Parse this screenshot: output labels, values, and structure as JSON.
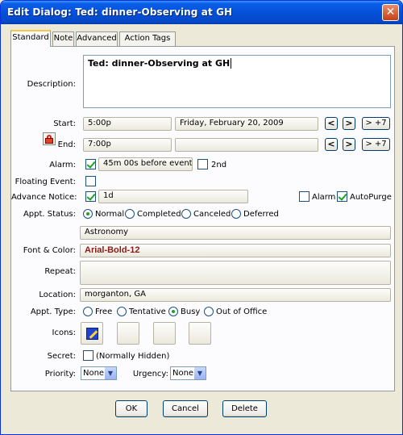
{
  "window": {
    "title": "Edit Dialog:  Ted: dinner-Observing at GH"
  },
  "tabs": [
    {
      "label": "Standard"
    },
    {
      "label": "Note"
    },
    {
      "label": "Advanced"
    },
    {
      "label": "Action Tags"
    }
  ],
  "form": {
    "description_label": "Description:",
    "description_value": "Ted: dinner-Observing at GH",
    "start_label": "Start:",
    "start_time": "5:00p",
    "start_date": "Friday, February 20, 2009",
    "end_label": "End:",
    "end_time": "7:00p",
    "end_date": "",
    "nav_prev": "<",
    "nav_next": ">",
    "nav_plus7": "> +7",
    "alarm_label": "Alarm:",
    "alarm_value": "45m 00s before event.",
    "alarm_checked": true,
    "second_alarm_label": "2nd",
    "second_alarm_checked": false,
    "floating_label": "Floating Event:",
    "floating_checked": false,
    "advance_label": "Advance Notice:",
    "advance_value": "1d",
    "advance_checked": true,
    "adv_alarm_label": "Alarm",
    "adv_alarm_checked": false,
    "autopurge_label": "AutoPurge",
    "autopurge_checked": true,
    "status_label": "Appt. Status:",
    "status_options": [
      "Normal",
      "Completed",
      "Canceled",
      "Deferred"
    ],
    "status_selected": "Normal",
    "category_value": "Astronomy",
    "font_label": "Font & Color:",
    "font_value": "Arial-Bold-12",
    "font_color": "#8b1a1a",
    "repeat_label": "Repeat:",
    "repeat_value": "",
    "location_label": "Location:",
    "location_value": "morganton, GA",
    "type_label": "Appt. Type:",
    "type_options": [
      "Free",
      "Tentative",
      "Busy",
      "Out of Office"
    ],
    "type_selected": "Busy",
    "icons_label": "Icons:",
    "icons": [
      "pencil-icon",
      "",
      "",
      ""
    ],
    "secret_label": "Secret:",
    "secret_text": "(Normally Hidden)",
    "secret_checked": false,
    "priority_label": "Priority:",
    "priority_value": "None",
    "urgency_label": "Urgency:",
    "urgency_value": "None"
  },
  "buttons": {
    "ok": "OK",
    "cancel": "Cancel",
    "delete": "Delete"
  },
  "colors": {
    "titlebar": "#0550d9",
    "tab_highlight": "#ffc83c",
    "check": "#21a121"
  }
}
